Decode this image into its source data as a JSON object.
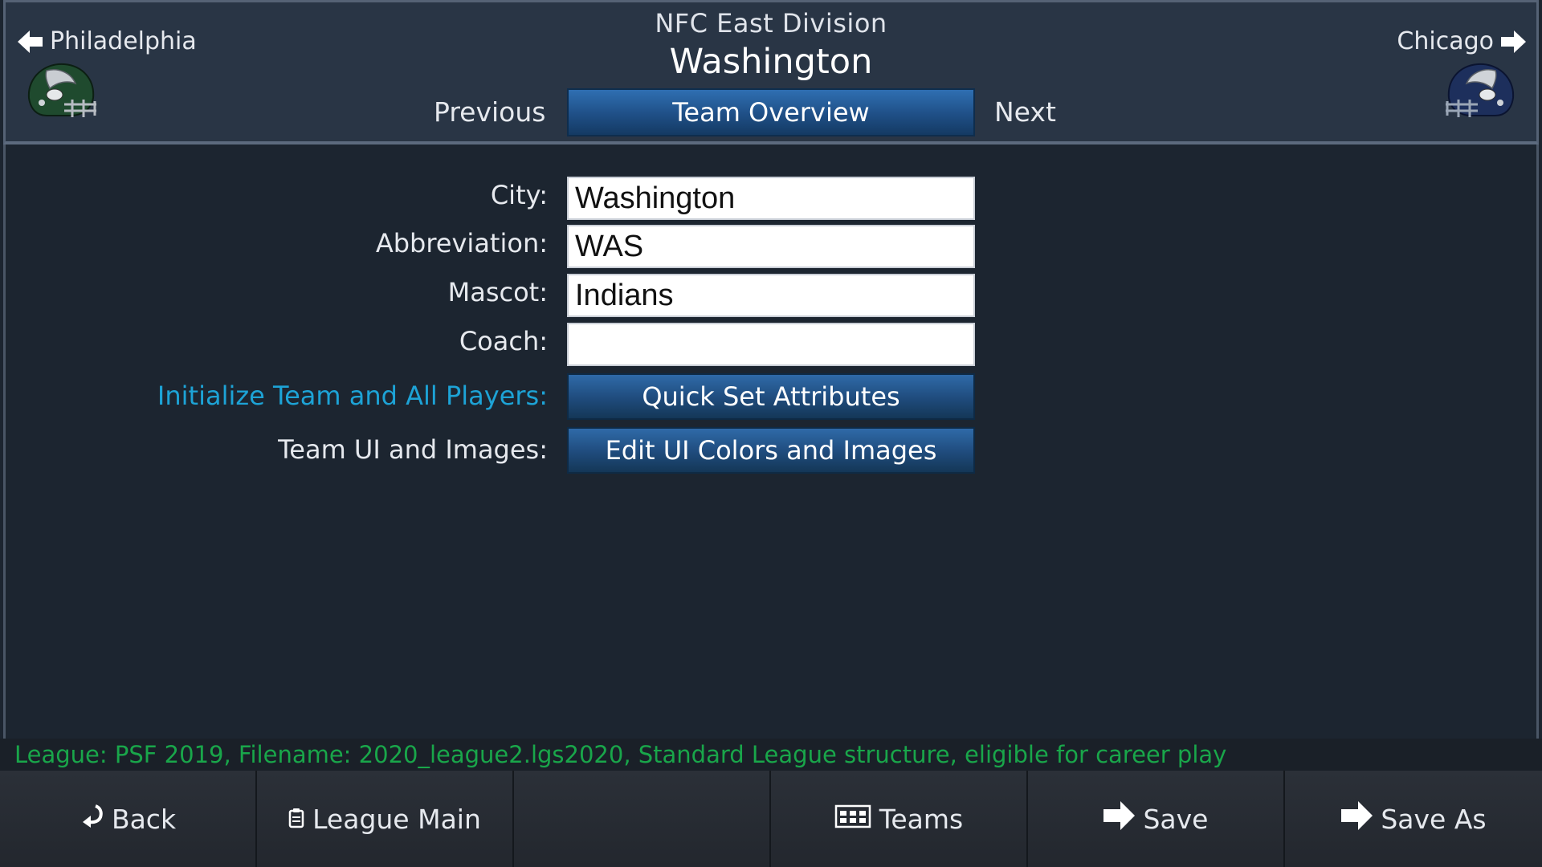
{
  "header": {
    "division": "NFC East Division",
    "team_name": "Washington",
    "prev_team": "Philadelphia",
    "next_team": "Chicago",
    "tab_prev": "Previous",
    "tab_active": "Team Overview",
    "tab_next": "Next"
  },
  "form": {
    "city_label": "City:",
    "city_value": "Washington",
    "abbr_label": "Abbreviation:",
    "abbr_value": "WAS",
    "mascot_label": "Mascot:",
    "mascot_value": "Indians",
    "coach_label": "Coach:",
    "coach_value": "",
    "init_label": "Initialize Team and All Players:",
    "init_button": "Quick Set Attributes",
    "ui_label": "Team UI and Images:",
    "ui_button": "Edit UI Colors and Images"
  },
  "status_text": "League: PSF 2019,  Filename: 2020_league2.lgs2020,  Standard League structure, eligible for career play",
  "footer": {
    "back": "Back",
    "league_main": "League Main",
    "teams": "Teams",
    "save": "Save",
    "save_as": "Save As"
  },
  "colors": {
    "background": "#1c2530",
    "header": "#293545",
    "button_blue": "#1f4f86",
    "cyan_label": "#1da3d6",
    "status_green": "#19a64a",
    "prev_helmet": "#1f4a2e",
    "next_helmet": "#1d2f5c"
  }
}
